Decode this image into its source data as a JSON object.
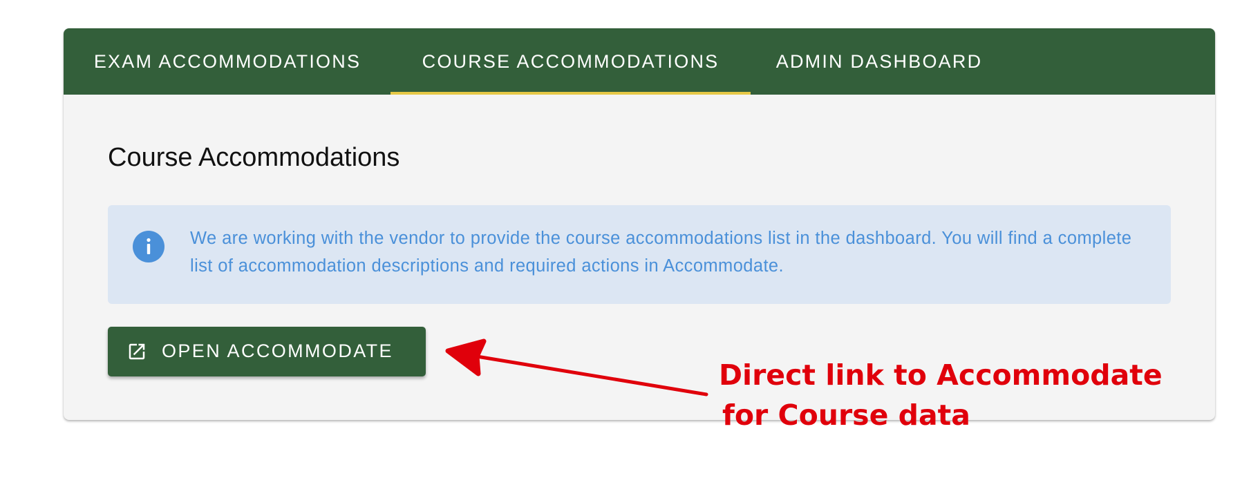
{
  "tabs": [
    {
      "label": "Exam Accommodations",
      "active": false
    },
    {
      "label": "Course Accommodations",
      "active": true
    },
    {
      "label": "Admin Dashboard",
      "active": false
    }
  ],
  "main": {
    "title": "Course Accommodations",
    "alert": {
      "icon": "info-icon",
      "text": "We are working with the vendor to provide the course accommodations list in the dashboard. You will find a complete list of accommodation descriptions and required actions in Accommodate."
    },
    "open_button": {
      "icon": "open-in-new-icon",
      "label": "OPEN ACCOMMODATE"
    }
  },
  "annotation": {
    "line1": "Direct link to Accommodate",
    "line2": "for Course data"
  },
  "colors": {
    "primary_green": "#335f3a",
    "tab_indicator": "#e6c846",
    "info_blue": "#4a90d9",
    "info_background": "#dce6f3",
    "annotation_red": "#e0000b"
  }
}
